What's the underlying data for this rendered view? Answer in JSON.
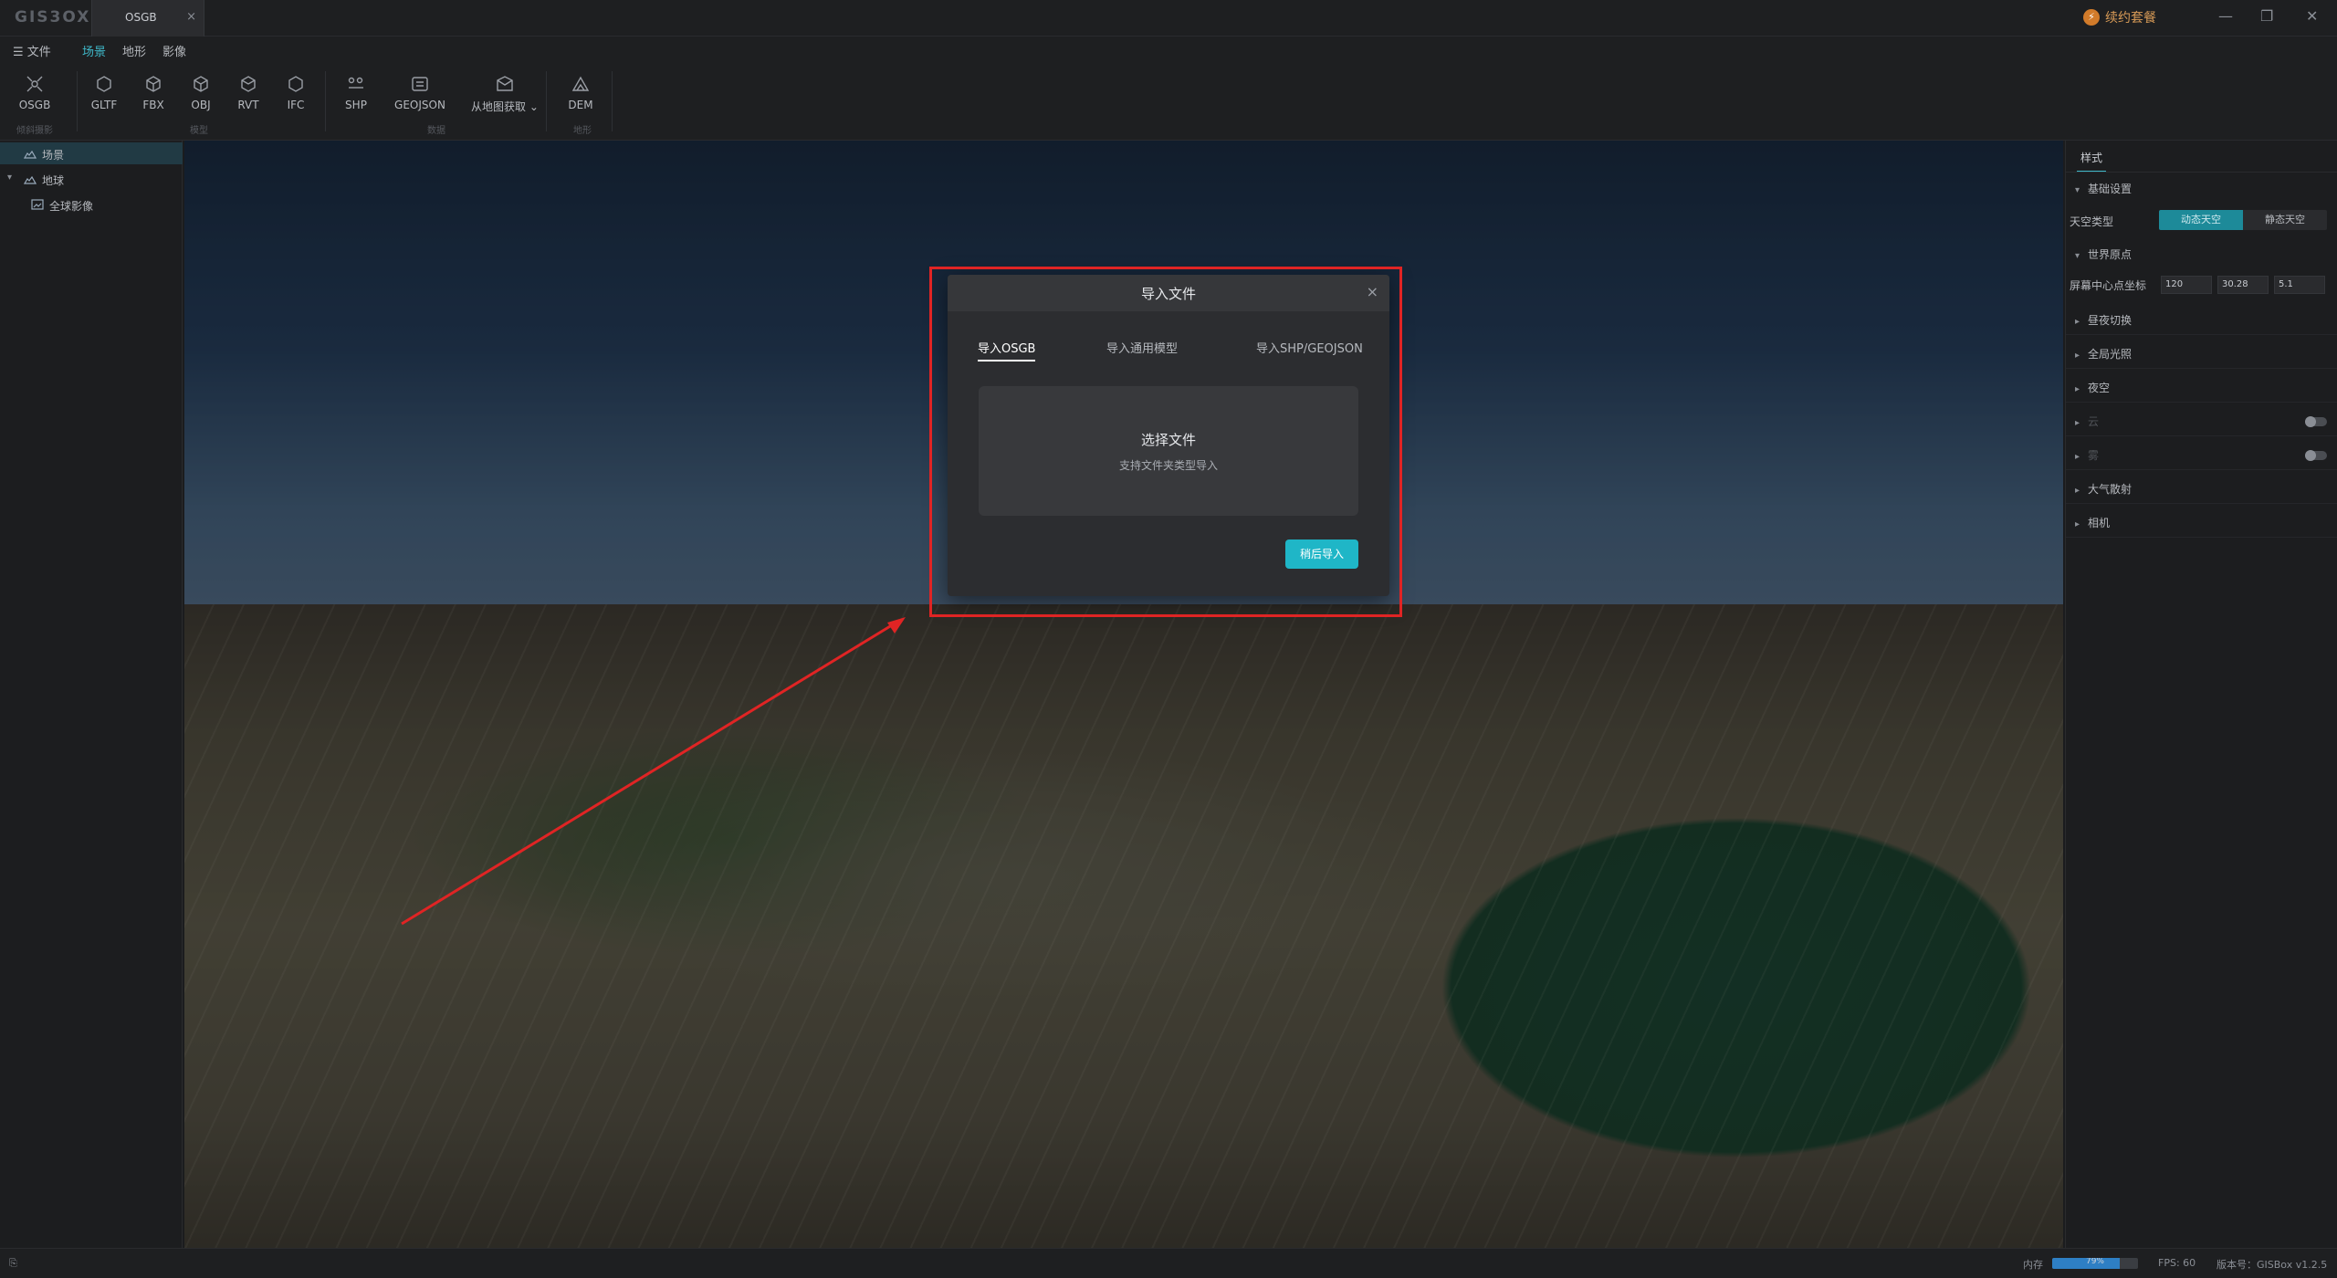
{
  "app": {
    "logo": "GIS3OX",
    "doc_tab": "OSGB",
    "renew": "续约套餐"
  },
  "menu": [
    {
      "label": "☰ 文件"
    },
    {
      "label": "场景"
    },
    {
      "label": "地形"
    },
    {
      "label": "影像"
    }
  ],
  "ribbon": {
    "buttons": [
      "OSGB",
      "GLTF",
      "FBX",
      "OBJ",
      "RVT",
      "IFC",
      "SHP",
      "GEOJSON",
      "从地图获取",
      "DEM"
    ],
    "groups": [
      "倾斜摄影",
      "模型",
      "数据",
      "地形"
    ]
  },
  "tree": [
    {
      "label": "场景"
    },
    {
      "label": "地球"
    },
    {
      "label": "全球影像"
    }
  ],
  "dialog": {
    "title": "导入文件",
    "tabs": [
      "导入OSGB",
      "导入通用模型",
      "导入SHP/GEOJSON"
    ],
    "drop_title": "选择文件",
    "drop_sub": "支持文件夹类型导入",
    "import_btn": "稍后导入"
  },
  "right": {
    "tab": "样式",
    "sections": [
      "基础设置",
      "世界原点",
      "昼夜切换",
      "全局光照",
      "夜空",
      "云",
      "雾",
      "大气散射",
      "相机"
    ],
    "sky_label": "天空类型",
    "sky_options": [
      "动态天空",
      "静态天空"
    ],
    "center_label": "屏幕中心点坐标",
    "coords": [
      "120",
      "30.28",
      "5.1"
    ]
  },
  "status": {
    "memory_label": "内存",
    "memory_pct": "79%",
    "memory_fraction": 0.79,
    "fps": "FPS: 60",
    "version": "版本号：GISBox v1.2.5"
  }
}
